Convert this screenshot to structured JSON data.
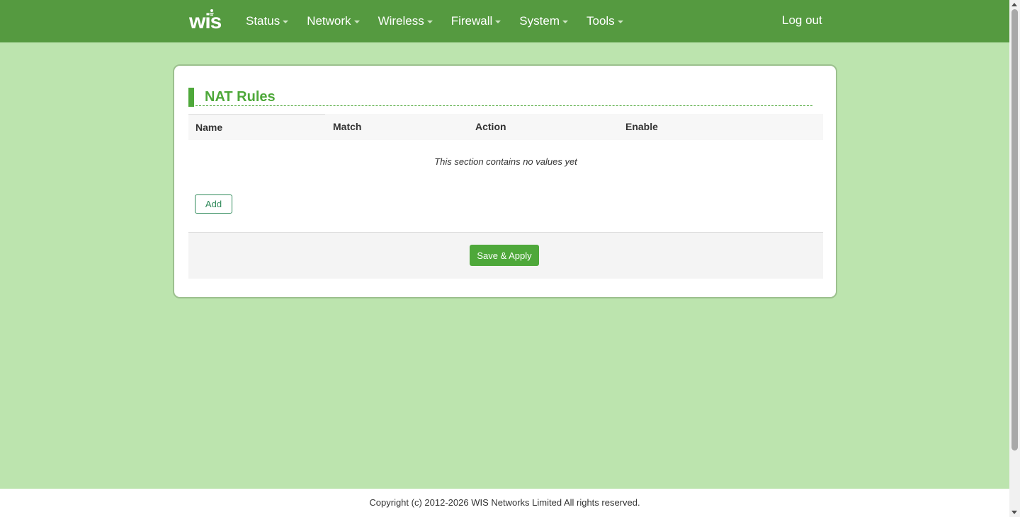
{
  "brand": {
    "logo_text": "WIS",
    "accent": "#559a40"
  },
  "nav": {
    "items": [
      {
        "label": "Status"
      },
      {
        "label": "Network"
      },
      {
        "label": "Wireless"
      },
      {
        "label": "Firewall"
      },
      {
        "label": "System"
      },
      {
        "label": "Tools"
      }
    ],
    "logout_label": "Log out"
  },
  "section": {
    "title": "NAT Rules",
    "columns": [
      "Name",
      "Match",
      "Action",
      "Enable"
    ],
    "empty_message": "This section contains no values yet",
    "add_label": "Add",
    "save_label": "Save & Apply"
  },
  "footer": {
    "copyright": "Copyright (c) 2012-2026 WIS Networks Limited All rights reserved."
  }
}
